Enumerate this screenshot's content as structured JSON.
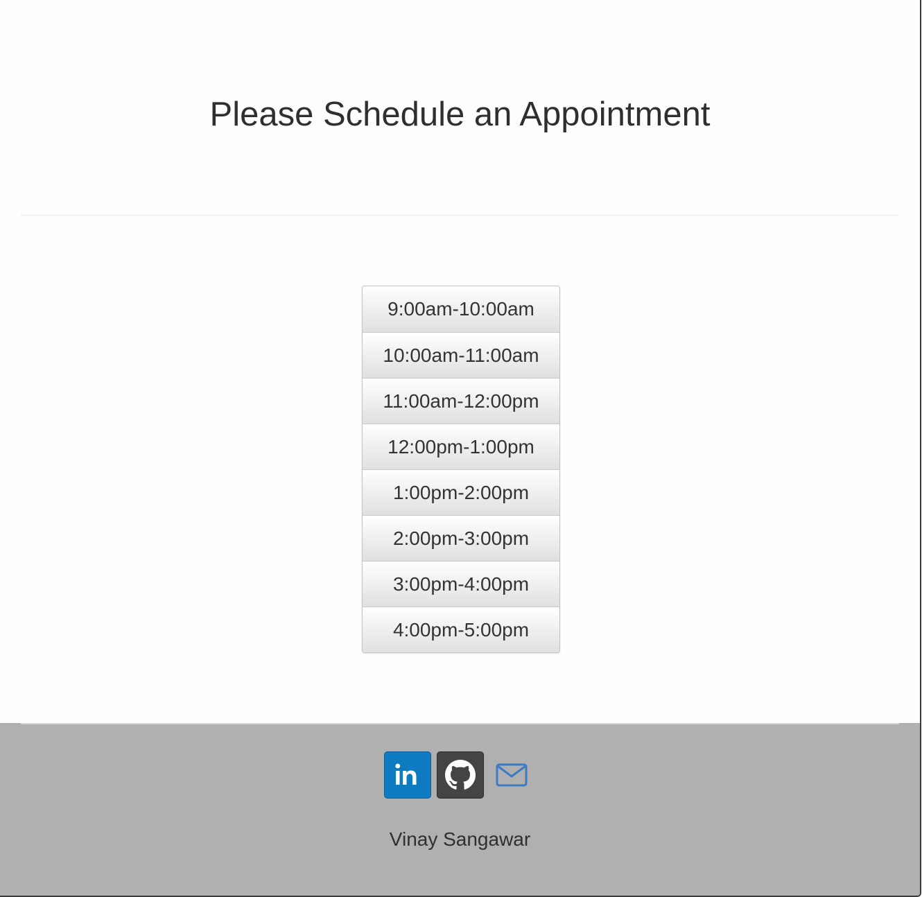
{
  "header": {
    "title": "Please Schedule an Appointment"
  },
  "schedule": {
    "slots": [
      "9:00am-10:00am",
      "10:00am-11:00am",
      "11:00am-12:00pm",
      "12:00pm-1:00pm",
      "1:00pm-2:00pm",
      "2:00pm-3:00pm",
      "3:00pm-4:00pm",
      "4:00pm-5:00pm"
    ]
  },
  "footer": {
    "social": [
      {
        "icon": "linkedin-icon",
        "color": "#0e7ac0"
      },
      {
        "icon": "github-icon",
        "color": "#444444"
      },
      {
        "icon": "mail-icon",
        "color": "#3c7bc4"
      }
    ],
    "author": "Vinay Sangawar",
    "background": "#b0b0b0"
  }
}
